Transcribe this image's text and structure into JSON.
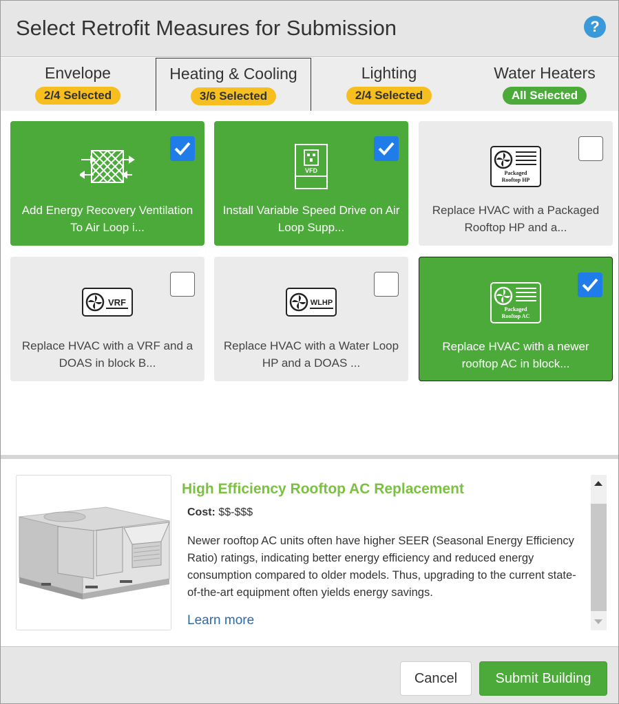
{
  "header": {
    "title": "Select Retrofit Measures for Submission",
    "help_icon": "question-circle-icon"
  },
  "tabs": [
    {
      "label": "Envelope",
      "badge": "2/4 Selected",
      "badge_color": "#f6be1e",
      "active": false
    },
    {
      "label": "Heating & Cooling",
      "badge": "3/6 Selected",
      "badge_color": "#f6be1e",
      "active": true
    },
    {
      "label": "Lighting",
      "badge": "2/4 Selected",
      "badge_color": "#f6be1e",
      "active": false
    },
    {
      "label": "Water Heaters",
      "badge": "All Selected",
      "badge_color": "#4caa3a",
      "active": false
    }
  ],
  "cards": [
    {
      "label": "Add Energy Recovery Ventilation To Air Loop i...",
      "checked": true,
      "icon": "energy-recovery-icon"
    },
    {
      "label": "Install Variable Speed Drive on Air Loop Supp...",
      "checked": true,
      "icon": "vfd-icon",
      "icon_text": "VFD"
    },
    {
      "label": "Replace HVAC with a Packaged Rooftop HP and a...",
      "checked": false,
      "icon": "packaged-rooftop-hp-icon",
      "icon_text": [
        "Packaged",
        "Rooftop HP"
      ]
    },
    {
      "label": "Replace HVAC with a VRF and a DOAS in block B...",
      "checked": false,
      "icon": "vrf-icon",
      "icon_text": "VRF"
    },
    {
      "label": "Replace HVAC with a Water Loop HP and a DOAS ...",
      "checked": false,
      "icon": "wlhp-icon",
      "icon_text": "WLHP"
    },
    {
      "label": "Replace HVAC with a newer rooftop AC in block...",
      "checked": true,
      "icon": "packaged-rooftop-ac-icon",
      "icon_text": [
        "Packaged",
        "Rooftop AC"
      ]
    }
  ],
  "detail": {
    "title": "High Efficiency Rooftop AC Replacement",
    "cost_label": "Cost:",
    "cost_value": "$$-$$$",
    "description": "Newer rooftop AC units often have higher SEER (Seasonal Energy Efficiency Ratio) ratings, indicating better energy efficiency and reduced energy consumption compared to older models. Thus, upgrading to the current state-of-the-art equipment often yields energy savings.",
    "learn_more": "Learn more",
    "image_icon": "rooftop-ac-unit-image"
  },
  "footer": {
    "cancel_label": "Cancel",
    "submit_label": "Submit Building"
  },
  "colors": {
    "accent_green": "#4caa3a",
    "badge_yellow": "#f6be1e",
    "checkbox_blue": "#1f7ce8",
    "title_green": "#7cc043",
    "link_blue": "#2c6aa8"
  }
}
